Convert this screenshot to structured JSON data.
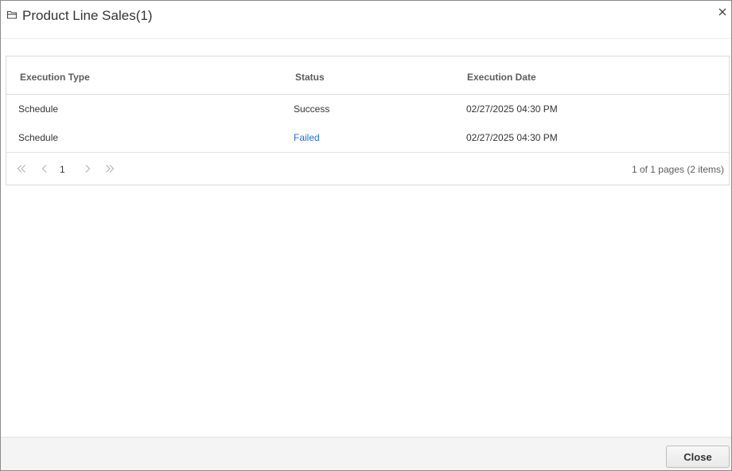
{
  "dialog": {
    "title": "Product Line Sales(1)",
    "icon": "folder-icon",
    "close_icon": "close-icon"
  },
  "grid": {
    "columns": [
      "Execution Type",
      "Status",
      "Execution Date"
    ],
    "rows": [
      {
        "type": "Schedule",
        "status": "Success",
        "date": "02/27/2025 04:30 PM"
      },
      {
        "type": "Schedule",
        "status": "Failed",
        "date": "02/27/2025 04:30 PM"
      }
    ]
  },
  "pager": {
    "first_icon": "double-chevron-left-icon",
    "prev_icon": "chevron-left-icon",
    "current_page": "1",
    "next_icon": "chevron-right-icon",
    "last_icon": "double-chevron-right-icon",
    "info": "1 of 1 pages (2 items)"
  },
  "footer": {
    "close_label": "Close"
  },
  "colors": {
    "failed_link": "#1f6fd0",
    "border": "#d9d9d9",
    "footer_bg": "#f4f4f4"
  }
}
